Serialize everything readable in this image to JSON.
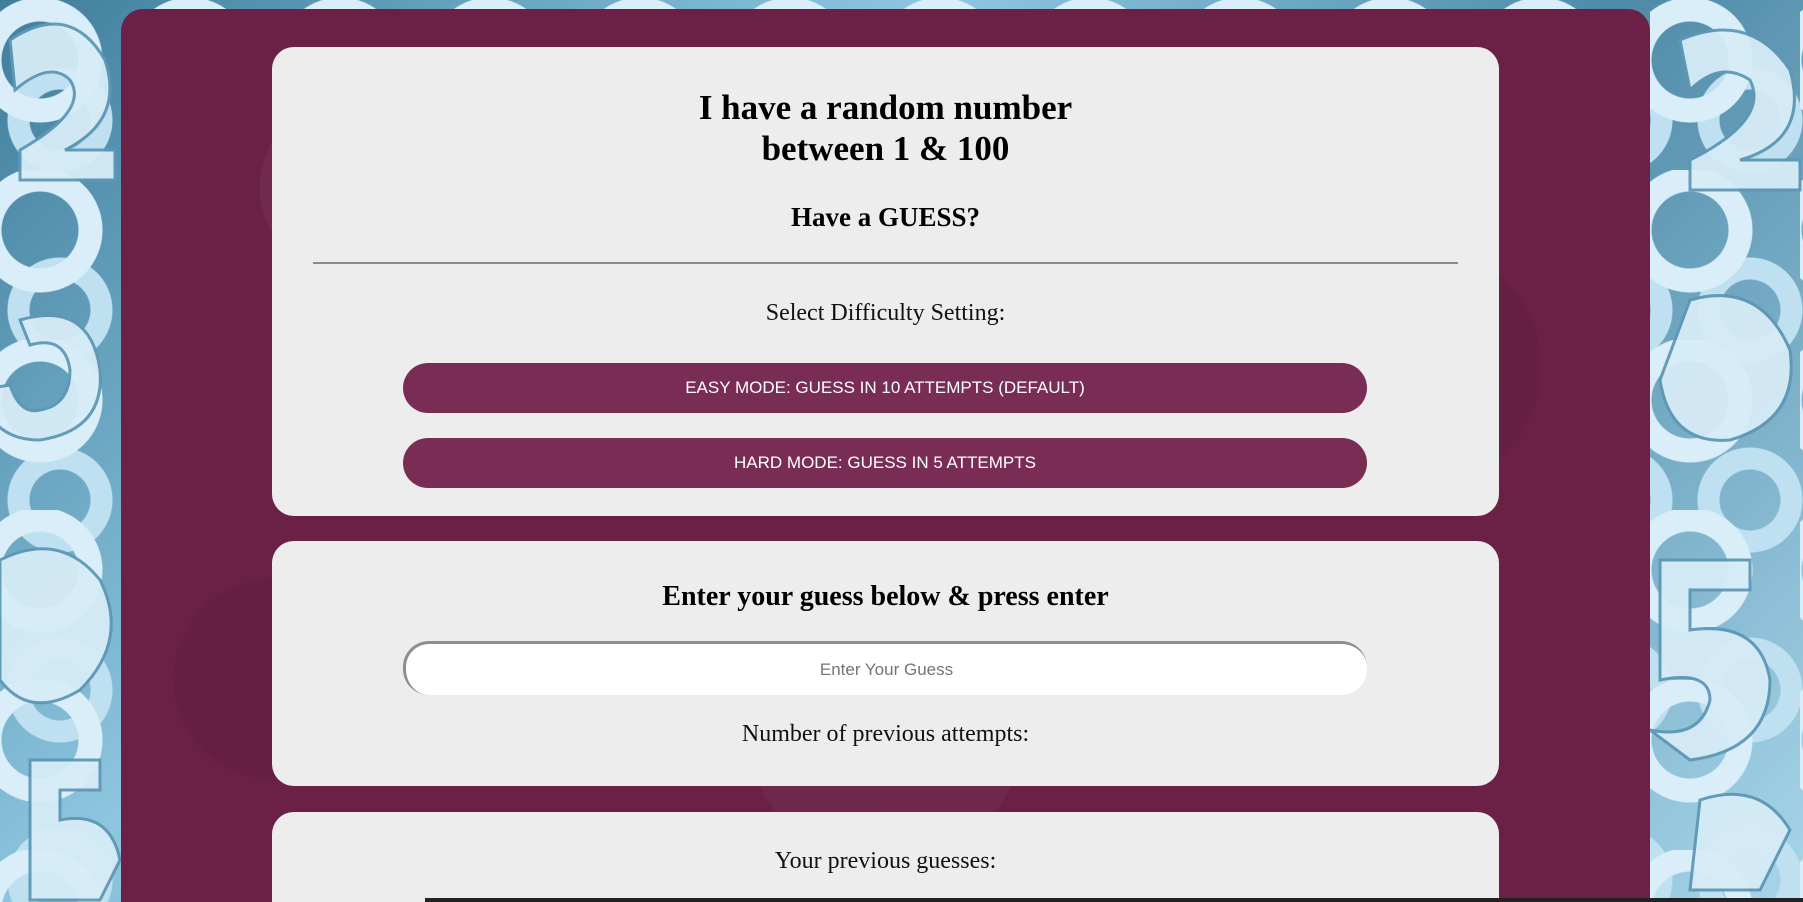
{
  "header": {
    "title_line1": "I have a random number",
    "title_line2": "between 1 & 100",
    "subtitle": "Have a GUESS?"
  },
  "difficulty": {
    "label": "Select Difficulty Setting:",
    "easy_label": "EASY MODE: GUESS IN 10 ATTEMPTS (DEFAULT)",
    "hard_label": "HARD MODE: GUESS IN 5 ATTEMPTS"
  },
  "guess": {
    "heading": "Enter your guess below & press enter",
    "placeholder": "Enter Your Guess",
    "attempts_label": "Number of previous attempts:"
  },
  "history": {
    "label": "Your previous guesses:"
  },
  "colors": {
    "panel": "#6a2145",
    "button": "#7a2d54",
    "card": "#ededed"
  }
}
